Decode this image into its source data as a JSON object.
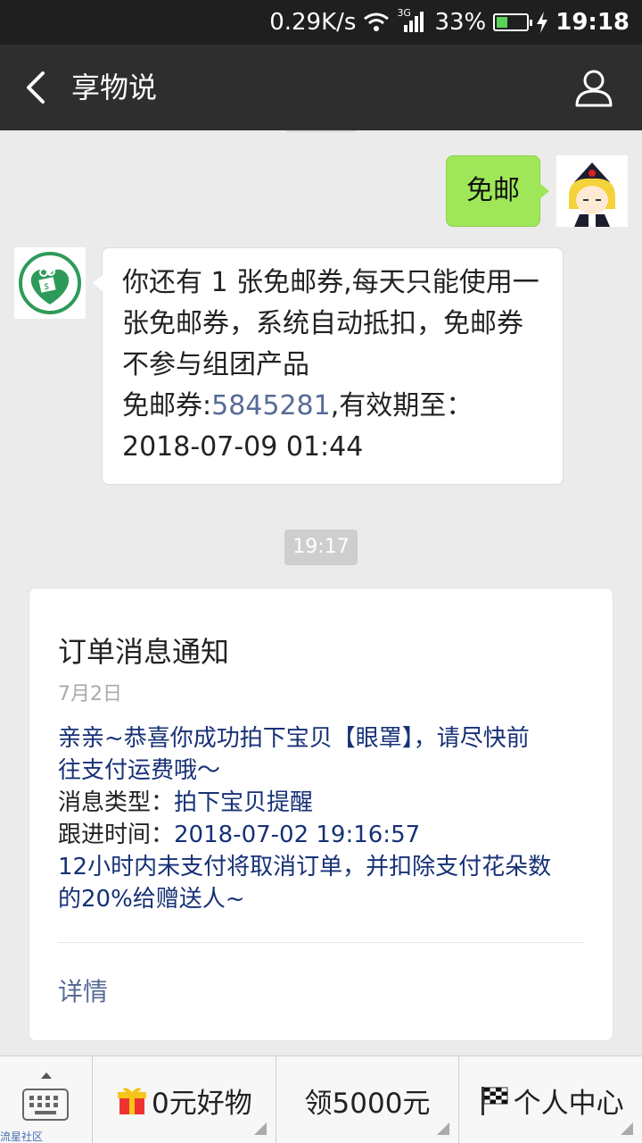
{
  "status_bar": {
    "net_speed": "0.29K/s",
    "network_type": "3G",
    "battery_percent": "33%",
    "battery_level": 0.33,
    "time": "19:18"
  },
  "header": {
    "title": "享物说"
  },
  "chat": {
    "messages": [
      {
        "from": "self",
        "text": "免邮"
      },
      {
        "from": "bot",
        "lines": [
          "你还有 1 张免邮券,每天只能使用一",
          "张免邮券，系统自动抵扣，免邮券",
          "不参与组团产品"
        ],
        "coupon_prefix": "免邮券:",
        "coupon_code": "5845281",
        "coupon_suffix": ",有效期至：",
        "expiry": "2018-07-09 01:44"
      }
    ],
    "timestamp": "19:17",
    "card": {
      "title": "订单消息通知",
      "date": "7月2日",
      "intro_line1": "亲亲~恭喜你成功拍下宝贝【眼罩】，请尽快前",
      "intro_line2": "往支付运费哦～",
      "type_label": "消息类型：",
      "type_value": "拍下宝贝提醒",
      "time_label": "跟进时间：",
      "time_value": "2018-07-02 19:16:57",
      "note_line1": "12小时内未支付将取消订单，并扣除支付花朵数",
      "note_line2": "的20%给赠送人~",
      "detail_label": "详情"
    }
  },
  "bottom_menu": {
    "watermark": "流星社区",
    "items": [
      {
        "label": "0元好物",
        "icon": "gift-icon"
      },
      {
        "label": "领5000元"
      },
      {
        "label": "个人中心",
        "icon": "checkered-flag-icon"
      }
    ]
  },
  "colors": {
    "self_bubble": "#9fe658",
    "link": "#576b95",
    "card_text": "#173177",
    "navbar": "#2e2e2e"
  }
}
